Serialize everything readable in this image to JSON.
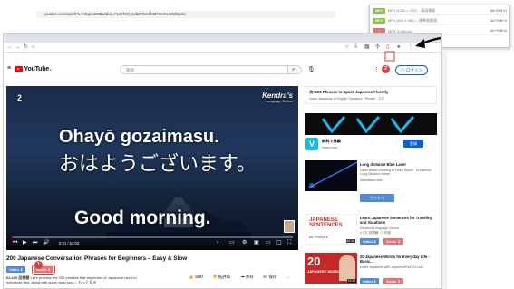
{
  "popup": {
    "items": [
      {
        "tag": "MP4",
        "color": "#8bc34a",
        "label": "MP4 (1280 x 720) – 高画質版",
        "key": "Alt+Shift+D"
      },
      {
        "tag": "MP4",
        "color": "#8bc34a",
        "label": "MP4 (640 x 360) – 標準画質版",
        "key": "Alt+Shift+S"
      },
      {
        "tag": "♪",
        "color": "#e57373",
        "label": "MP3 (128kbps)",
        "key": "Alt+Shift+A"
      },
      {
        "tag": "♪",
        "color": "#e57373",
        "label": "M4A (128kbps)",
        "key": ""
      }
    ]
  },
  "browser": {
    "url": "youtube.com/watch?v=YEqe1C6iBU&list=PL4Yf2nl_CdDP8nn1CM7GVXLiSN3Quko",
    "search_placeholder": "検索",
    "login_label": "ログイン"
  },
  "logo": {
    "text": "YouTube",
    "region": "JP"
  },
  "video": {
    "number": "2",
    "brand": "Kendra's",
    "brand_sub": "Language School",
    "romaji": "Ohayō gozaimasu.",
    "kana": "おはようございます。",
    "english": "Good morning.",
    "time": "0:21 / 53:03",
    "progress": 0.007,
    "title": "200 Japanese Conversation Phrases for Beginners – Easy & Slow",
    "video_badge": "Video ⇩",
    "audio_badge": "Audio ⇩",
    "views": "64,426 回視聴",
    "desc": "Let's practice the 200 phrases that beginners of Japanese need to memorize first, along with super slow succ... もっと見る",
    "likes": "1687",
    "dislike": "低評価",
    "share": "共有",
    "save": "保存",
    "more": "…"
  },
  "markers": {
    "one": "1",
    "two": "2"
  },
  "sidebar": {
    "playlist_title": "次: 100 Phrases to Speak Japanese Fluently",
    "playlist_sub": "Learn Japanese in English Speakers · Private · 1/17",
    "ad_title": "無料で体験",
    "ad_sub": "vimeo.com",
    "ad_button": "登録",
    "items": [
      {
        "title": "Long distance Blue Laser",
        "sub": "Laser Beam reaching to Deep Space · Enhanced Long Distance Beam",
        "channel": "bairealaser.com",
        "button": "サイトへ",
        "duration": ""
      },
      {
        "title": "Learn Japanese Sentences for Traveling and Vacations",
        "sub": "Kendra's Language School",
        "channel": "4.7万 回視聴・2 年前",
        "button": "",
        "duration": "42:16"
      },
      {
        "title": "20 Japanese Words for Everyday Life - Basic...",
        "sub": "Learn Japanese with JapanesePod101.com",
        "channel": "",
        "button": "",
        "duration": "12:11"
      }
    ],
    "thumb2_text": "JAPANESE SENTENCES",
    "thumb2_sub": "for TRAVEL",
    "thumb3_num": "20",
    "thumb3_text": "JAPANESE WORDS"
  },
  "colors": {
    "accent": "#065fd4",
    "video_badge": "#4f8bd8",
    "audio_badge": "#e57373",
    "marker": "#e53935"
  }
}
